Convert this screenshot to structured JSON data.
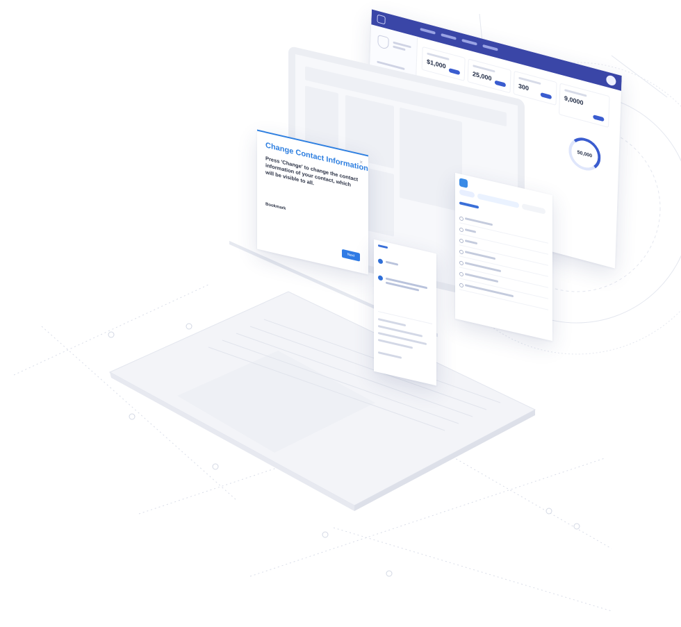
{
  "modal": {
    "title": "Change Contact Information",
    "body": "Press 'Change' to change the contact information of your contact, which will be visible to all.",
    "link": "Bookmark",
    "button": "Next"
  },
  "dashboard": {
    "stats": [
      "$1,000",
      "25,000",
      "300",
      "9,0000"
    ],
    "ring_value": "50,000"
  },
  "colors": {
    "brand": "#3a46a7",
    "accent": "#2e7fe0"
  }
}
